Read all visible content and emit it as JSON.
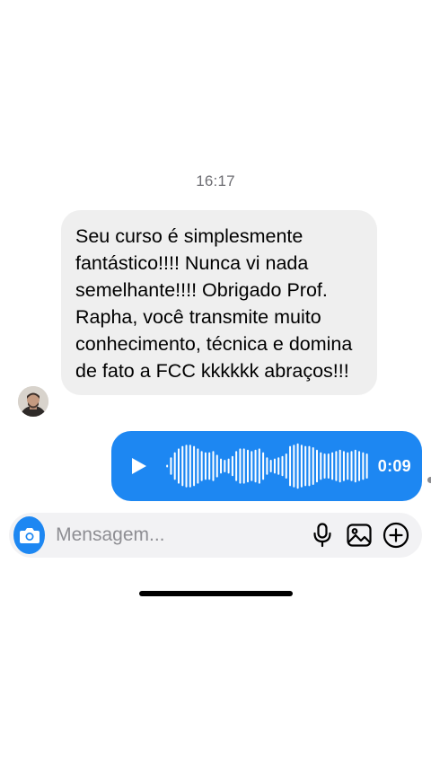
{
  "conversation": {
    "timestamp": "16:17",
    "incoming": {
      "text": "Seu curso é simplesmente fantástico!!!! Nunca vi nada semelhante!!!! Obrigado Prof. Rapha, você transmite muito conhecimento, técnica e domina de fato a FCC kkkkkk abraços!!!"
    },
    "outgoing_audio": {
      "duration": "0:09",
      "waveform": [
        0.05,
        0.35,
        0.55,
        0.7,
        0.8,
        0.85,
        0.85,
        0.8,
        0.7,
        0.6,
        0.55,
        0.55,
        0.6,
        0.45,
        0.3,
        0.25,
        0.3,
        0.4,
        0.6,
        0.7,
        0.7,
        0.65,
        0.6,
        0.65,
        0.7,
        0.55,
        0.35,
        0.25,
        0.3,
        0.35,
        0.4,
        0.5,
        0.8,
        0.85,
        0.9,
        0.85,
        0.8,
        0.8,
        0.75,
        0.65,
        0.55,
        0.5,
        0.5,
        0.55,
        0.6,
        0.65,
        0.6,
        0.55,
        0.6,
        0.65,
        0.6,
        0.55,
        0.5
      ]
    }
  },
  "composer": {
    "placeholder": "Mensagem...",
    "icons": [
      "camera-icon",
      "microphone-icon",
      "image-icon",
      "plus-circle-icon"
    ]
  },
  "colors": {
    "accent": "#1d87f2",
    "incoming_bubble": "#efefef",
    "timestamp": "#6e6e73"
  }
}
